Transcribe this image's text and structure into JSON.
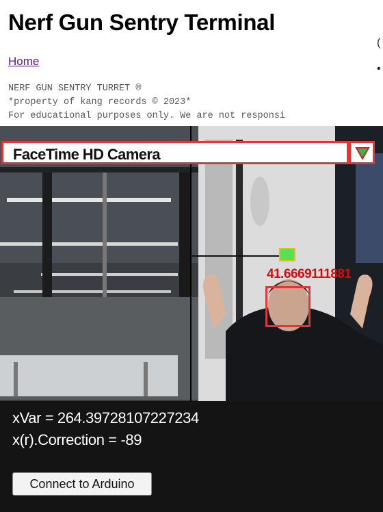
{
  "page": {
    "title": "Nerf Gun Sentry Terminal",
    "home_link": "Home",
    "lines": [
      "NERF GUN SENTRY TURRET ®",
      "*property of kang records © 2023*",
      "For educational purposes only. We are not responsi"
    ]
  },
  "camera": {
    "select_value": "FaceTime HD Camera",
    "angle_label": "41.6669111881",
    "accent_color": "#e23636",
    "target_color": "#55e055"
  },
  "readout": {
    "x_var": "xVar = 264.39728107227234",
    "x_correction": "x(r).Correction = -89"
  },
  "buttons": {
    "connect": "Connect to Arduino"
  }
}
